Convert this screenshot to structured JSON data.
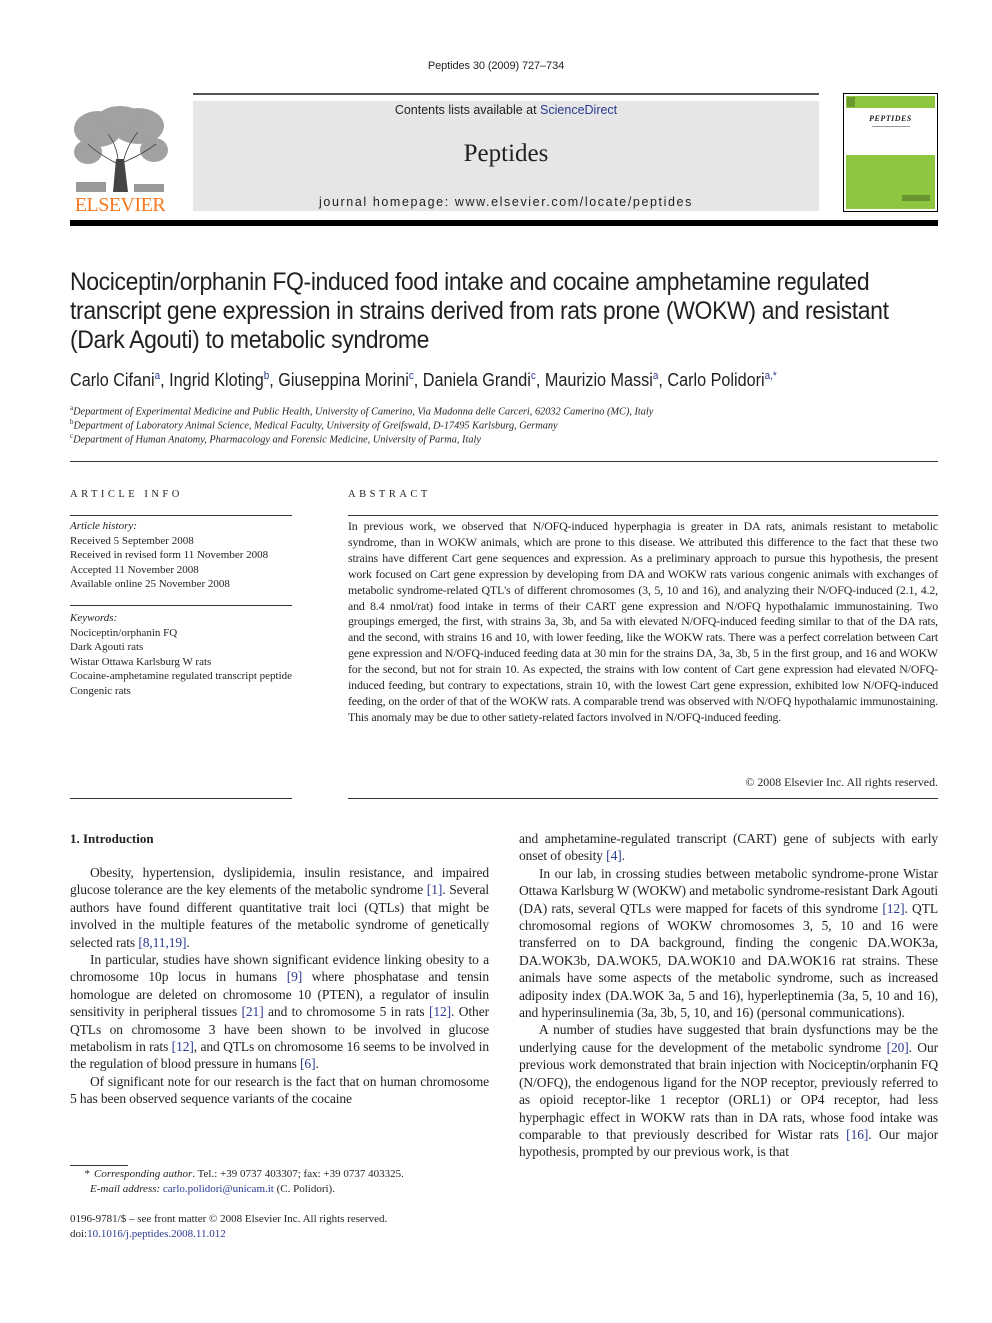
{
  "header": {
    "running_head": "Peptides 30 (2009) 727–734",
    "contents_prefix": "Contents lists available at ",
    "contents_link": "ScienceDirect",
    "journal_name": "Peptides",
    "homepage": "journal homepage: www.elsevier.com/locate/peptides",
    "publisher_logo_text": "ELSEVIER",
    "cover_title": "PEPTIDES",
    "colors": {
      "publisher_orange": "#f47920",
      "cover_green": "#8dc63f",
      "link_blue": "#2b3990",
      "banner_gray": "#e6e6e6"
    }
  },
  "article": {
    "title": "Nociceptin/orphanin FQ-induced food intake and cocaine amphetamine regulated transcript gene expression in strains derived from rats prone (WOKW) and resistant (Dark Agouti) to metabolic syndrome",
    "authors": [
      {
        "name": "Carlo Cifani",
        "aff": "a"
      },
      {
        "name": "Ingrid Kloting",
        "aff": "b"
      },
      {
        "name": "Giuseppina Morini",
        "aff": "c"
      },
      {
        "name": "Daniela Grandi",
        "aff": "c"
      },
      {
        "name": "Maurizio Massi",
        "aff": "a"
      },
      {
        "name": "Carlo Polidori",
        "aff": "a,*"
      }
    ],
    "affiliations": [
      {
        "key": "a",
        "text": "Department of Experimental Medicine and Public Health, University of Camerino, Via Madonna delle Carceri, 62032 Camerino (MC), Italy"
      },
      {
        "key": "b",
        "text": "Department of Laboratory Animal Science, Medical Faculty, University of Greifswald, D-17495 Karlsburg, Germany"
      },
      {
        "key": "c",
        "text": "Department of Human Anatomy, Pharmacology and Forensic Medicine, University of Parma, Italy"
      }
    ]
  },
  "article_info": {
    "label": "ARTICLE INFO",
    "history_label": "Article history:",
    "history": [
      "Received 5 September 2008",
      "Received in revised form 11 November 2008",
      "Accepted 11 November 2008",
      "Available online 25 November 2008"
    ],
    "keywords_label": "Keywords:",
    "keywords": [
      "Nociceptin/orphanin FQ",
      "Dark Agouti rats",
      "Wistar Ottawa Karlsburg W rats",
      "Cocaine-amphetamine regulated transcript peptide",
      "Congenic rats"
    ]
  },
  "abstract": {
    "label": "ABSTRACT",
    "text": "In previous work, we observed that N/OFQ-induced hyperphagia is greater in DA rats, animals resistant to metabolic syndrome, than in WOKW animals, which are prone to this disease. We attributed this difference to the fact that these two strains have different Cart gene sequences and expression. As a preliminary approach to pursue this hypothesis, the present work focused on Cart gene expression by developing from DA and WOKW rats various congenic animals with exchanges of metabolic syndrome-related QTL's of different chromosomes (3, 5, 10 and 16), and analyzing their N/OFQ-induced (2.1, 4.2, and 8.4 nmol/rat) food intake in terms of their CART gene expression and N/OFQ hypothalamic immunostaining. Two groupings emerged, the first, with strains 3a, 3b, and 5a with elevated N/OFQ-induced feeding similar to that of the DA rats, and the second, with strains 16 and 10, with lower feeding, like the WOKW rats. There was a perfect correlation between Cart gene expression and N/OFQ-induced feeding data at 30 min for the strains DA, 3a, 3b, 5 in the first group, and 16 and WOKW for the second, but not for strain 10. As expected, the strains with low content of Cart gene expression had elevated N/OFQ-induced feeding, but contrary to expectations, strain 10, with the lowest Cart gene expression, exhibited low N/OFQ-induced feeding, on the order of that of the WOKW rats. A comparable trend was observed with N/OFQ hypothalamic immunostaining. This anomaly may be due to other satiety-related factors involved in N/OFQ-induced feeding.",
    "copyright": "© 2008 Elsevier Inc. All rights reserved."
  },
  "introduction": {
    "heading": "1. Introduction",
    "left_paragraphs": [
      [
        {
          "t": "Obesity, hypertension, dyslipidemia, insulin resistance, and impaired glucose tolerance are the key elements of the metabolic syndrome "
        },
        {
          "ref": "[1]"
        },
        {
          "t": ". Several authors have found different quantitative trait loci (QTLs) that might be involved in the multiple features of the metabolic syndrome of genetically selected rats "
        },
        {
          "ref": "[8,11,19]"
        },
        {
          "t": "."
        }
      ],
      [
        {
          "t": "In particular, studies have shown significant evidence linking obesity to a chromosome 10p locus in humans "
        },
        {
          "ref": "[9]"
        },
        {
          "t": " where phosphatase and tensin homologue are deleted on chromosome 10 (PTEN), a regulator of insulin sensitivity in peripheral tissues "
        },
        {
          "ref": "[21]"
        },
        {
          "t": " and to chromosome 5 in rats "
        },
        {
          "ref": "[12]"
        },
        {
          "t": ". Other QTLs on chromosome 3 have been shown to be involved in glucose metabolism in rats "
        },
        {
          "ref": "[12]"
        },
        {
          "t": ", and QTLs on chromosome 16 seems to be involved in the regulation of blood pressure in humans "
        },
        {
          "ref": "[6]"
        },
        {
          "t": "."
        }
      ],
      [
        {
          "t": "Of significant note for our research is the fact that on human chromosome 5 has been observed sequence variants of the cocaine"
        }
      ]
    ],
    "right_paragraphs": [
      [
        {
          "t": "and amphetamine-regulated transcript (CART) gene of subjects with early onset of obesity "
        },
        {
          "ref": "[4]"
        },
        {
          "t": "."
        }
      ],
      [
        {
          "t": "In our lab, in crossing studies between metabolic syndrome-prone Wistar Ottawa Karlsburg W (WOKW) and metabolic syndrome-resistant Dark Agouti (DA) rats, several QTLs were mapped for facets of this syndrome "
        },
        {
          "ref": "[12]"
        },
        {
          "t": ". QTL chromosomal regions of WOKW chromosomes 3, 5, 10 and 16 were transferred on to DA background, finding the congenic DA.WOK3a, DA.WOK3b, DA.WOK5, DA.WOK10 and DA.WOK16 rat strains. These animals have some aspects of the metabolic syndrome, such as increased adiposity index (DA.WOK 3a, 5 and 16), hyperleptinemia (3a, 5, 10 and 16), and hyperinsulinemia (3a, 3b, 5, 10, and 16) (personal communications)."
        }
      ],
      [
        {
          "t": "A number of studies have suggested that brain dysfunctions may be the underlying cause for the development of the metabolic syndrome "
        },
        {
          "ref": "[20]"
        },
        {
          "t": ". Our previous work demonstrated that brain injection with Nociceptin/orphanin FQ (N/OFQ), the endogenous ligand for the NOP receptor, previously referred to as opioid receptor-like 1 receptor (ORL1) or OP4 receptor, had less hyperphagic effect in WOKW rats than in DA rats, whose food intake was comparable to that previously described for Wistar rats "
        },
        {
          "ref": "[16]"
        },
        {
          "t": ". Our major hypothesis, prompted by our previous work, is that"
        }
      ]
    ]
  },
  "footnotes": {
    "corresponding_marker": "*",
    "corresponding_label": "Corresponding author",
    "corresponding_contact": ". Tel.: +39 0737 403307; fax: +39 0737 403325.",
    "email_label": "E-mail address:",
    "email": "carlo.polidori@unicam.it",
    "email_suffix": " (C. Polidori).",
    "issn_line": "0196-9781/$ – see front matter © 2008 Elsevier Inc. All rights reserved.",
    "doi_prefix": "doi:",
    "doi": "10.1016/j.peptides.2008.11.012"
  }
}
